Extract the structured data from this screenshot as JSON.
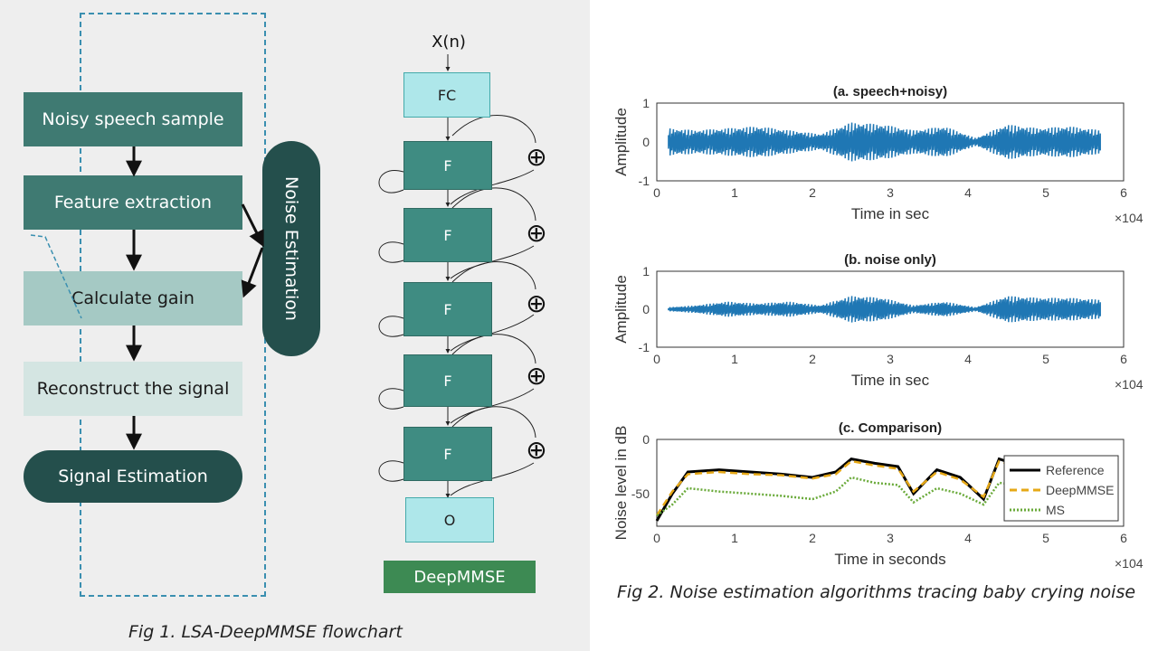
{
  "fig1": {
    "caption": "Fig 1. LSA-DeepMMSE flowchart",
    "steps": [
      {
        "label": "Noisy speech sample"
      },
      {
        "label": "Feature extraction"
      },
      {
        "label": "Calculate gain"
      },
      {
        "label": "Reconstruct the signal"
      },
      {
        "label": "Signal Estimation"
      }
    ],
    "side_block": "Noise Estimation",
    "network": {
      "input_label": "X(n)",
      "first_layer": "FC",
      "blocks": [
        "F",
        "F",
        "F",
        "F",
        "F"
      ],
      "output_layer": "O",
      "name": "DeepMMSE",
      "sum_symbol": "⊕"
    }
  },
  "fig2": {
    "caption": "Fig 2. Noise estimation algorithms tracing baby crying noise"
  },
  "chart_data": [
    {
      "type": "line",
      "title": "(a. speech+noisy)",
      "xlabel": "Time in sec",
      "ylabel": "Amplitude",
      "x_multiplier": "×10^4",
      "xlim": [
        0,
        6
      ],
      "ylim": [
        -1,
        1
      ],
      "xticks": [
        "0",
        "1",
        "2",
        "3",
        "4",
        "5",
        "6"
      ],
      "yticks": [
        "1",
        "0",
        "-1"
      ],
      "series": [
        {
          "name": "signal",
          "color": "#1f77b4",
          "x": [
            0.15,
            0.5,
            0.9,
            1.3,
            1.7,
            2.1,
            2.5,
            2.9,
            3.3,
            3.7,
            4.1,
            4.5,
            4.9,
            5.3,
            5.7
          ],
          "envelope": [
            0.35,
            0.3,
            0.35,
            0.4,
            0.3,
            0.2,
            0.5,
            0.45,
            0.3,
            0.4,
            0.1,
            0.45,
            0.35,
            0.4,
            0.3
          ]
        }
      ]
    },
    {
      "type": "line",
      "title": "(b. noise only)",
      "xlabel": "Time in sec",
      "ylabel": "Amplitude",
      "x_multiplier": "×10^4",
      "xlim": [
        0,
        6
      ],
      "ylim": [
        -1,
        1
      ],
      "xticks": [
        "0",
        "1",
        "2",
        "3",
        "4",
        "5",
        "6"
      ],
      "yticks": [
        "1",
        "0",
        "-1"
      ],
      "series": [
        {
          "name": "noise",
          "color": "#1f77b4",
          "x": [
            0.15,
            0.5,
            0.9,
            1.3,
            1.7,
            2.1,
            2.5,
            2.9,
            3.3,
            3.7,
            4.1,
            4.5,
            4.9,
            5.3,
            5.7
          ],
          "envelope": [
            0.05,
            0.1,
            0.2,
            0.15,
            0.2,
            0.1,
            0.35,
            0.3,
            0.1,
            0.2,
            0.05,
            0.35,
            0.3,
            0.3,
            0.25
          ]
        }
      ]
    },
    {
      "type": "line",
      "title": "(c. Comparison)",
      "xlabel": "Time in seconds",
      "ylabel": "Noise level in dB",
      "x_multiplier": "×10^4",
      "xlim": [
        0,
        6
      ],
      "ylim": [
        -80,
        0
      ],
      "xticks": [
        "0",
        "1",
        "2",
        "3",
        "4",
        "5",
        "6"
      ],
      "yticks": [
        "0",
        "-50"
      ],
      "legend_position": "right",
      "series": [
        {
          "name": "Reference",
          "color": "#000000",
          "style": "solid",
          "x": [
            0,
            0.2,
            0.4,
            0.8,
            1.2,
            1.6,
            2.0,
            2.3,
            2.5,
            2.8,
            3.1,
            3.3,
            3.6,
            3.9,
            4.2,
            4.4,
            4.7,
            5.0,
            5.3,
            5.6
          ],
          "y": [
            -75,
            -50,
            -30,
            -28,
            -30,
            -32,
            -35,
            -30,
            -18,
            -22,
            -25,
            -50,
            -28,
            -35,
            -55,
            -18,
            -25,
            -30,
            -30,
            -20
          ]
        },
        {
          "name": "DeepMMSE",
          "color": "#e6a817",
          "style": "dashed",
          "x": [
            0,
            0.2,
            0.4,
            0.8,
            1.2,
            1.6,
            2.0,
            2.3,
            2.5,
            2.8,
            3.1,
            3.3,
            3.6,
            3.9,
            4.2,
            4.4,
            4.7,
            5.0,
            5.3,
            5.6
          ],
          "y": [
            -70,
            -48,
            -32,
            -30,
            -32,
            -33,
            -36,
            -32,
            -20,
            -24,
            -27,
            -48,
            -30,
            -37,
            -53,
            -20,
            -26,
            -32,
            -30,
            -22
          ]
        },
        {
          "name": "MS",
          "color": "#6aaa3a",
          "style": "dotted",
          "x": [
            0,
            0.2,
            0.4,
            0.8,
            1.2,
            1.6,
            2.0,
            2.3,
            2.5,
            2.8,
            3.1,
            3.3,
            3.6,
            3.9,
            4.2,
            4.4,
            4.7,
            5.0,
            5.3,
            5.6
          ],
          "y": [
            -70,
            -60,
            -45,
            -48,
            -50,
            -52,
            -55,
            -48,
            -35,
            -40,
            -42,
            -58,
            -45,
            -50,
            -60,
            -40,
            -42,
            -46,
            -45,
            -40
          ]
        }
      ]
    }
  ]
}
